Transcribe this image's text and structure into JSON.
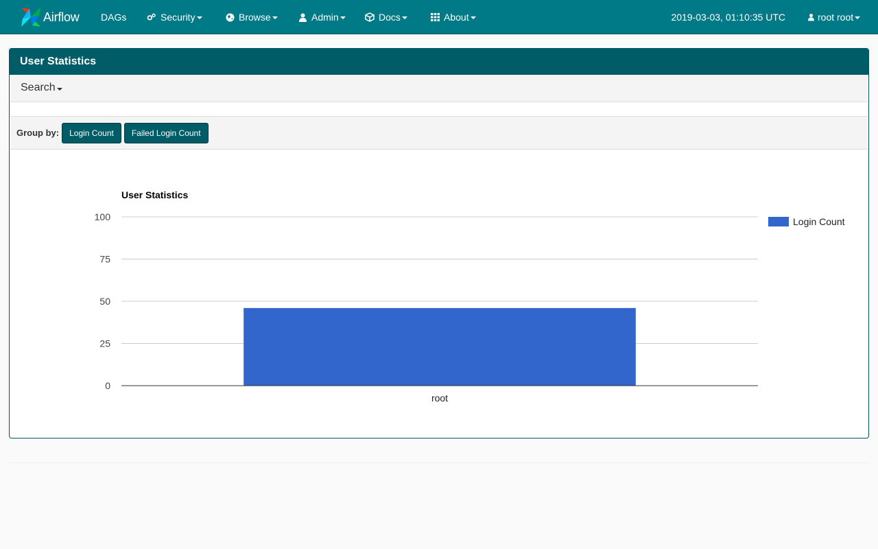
{
  "nav": {
    "brand": "Airflow",
    "items": [
      {
        "label": "DAGs",
        "icon": "none",
        "dropdown": false
      },
      {
        "label": "Security",
        "icon": "gears-icon",
        "dropdown": true
      },
      {
        "label": "Browse",
        "icon": "globe-icon",
        "dropdown": true
      },
      {
        "label": "Admin",
        "icon": "user-icon",
        "dropdown": true
      },
      {
        "label": "Docs",
        "icon": "cube-icon",
        "dropdown": true
      },
      {
        "label": "About",
        "icon": "grid-icon",
        "dropdown": true
      }
    ],
    "time": "2019-03-03, 01:10:35 UTC",
    "user": "root root"
  },
  "panel": {
    "title": "User Statistics",
    "search_label": "Search",
    "groupby_label": "Group by:",
    "buttons": [
      "Login Count",
      "Failed Login Count"
    ]
  },
  "colors": {
    "navbar": "#007a87",
    "panel_heading": "#005c66",
    "bar": "#3366cc"
  },
  "chart_data": {
    "type": "bar",
    "title": "User Statistics",
    "categories": [
      "root"
    ],
    "series": [
      {
        "name": "Login Count",
        "values": [
          46
        ]
      }
    ],
    "ylim": [
      0,
      100
    ],
    "yticks": [
      0,
      25,
      50,
      75,
      100
    ],
    "grid": true,
    "legend": "right"
  }
}
